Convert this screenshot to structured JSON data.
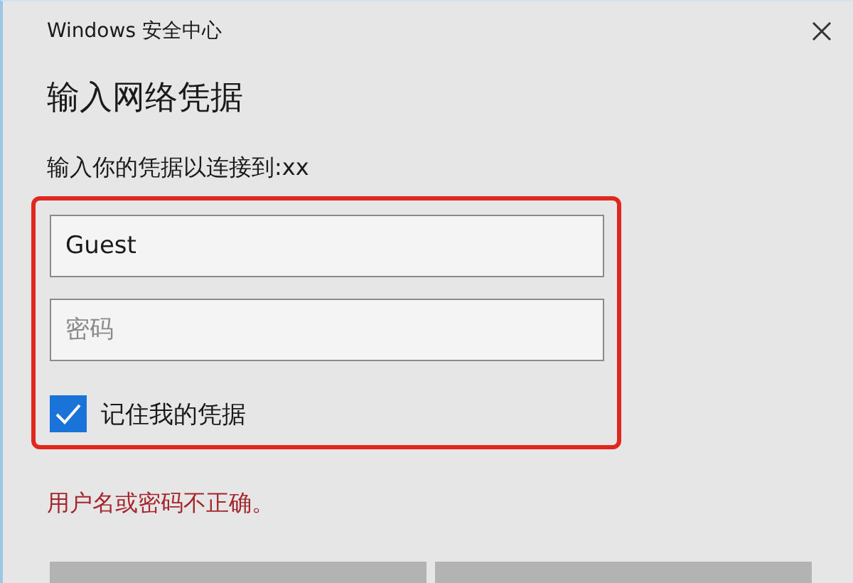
{
  "window": {
    "title": "Windows 安全中心"
  },
  "heading": "输入网络凭据",
  "prompt": "输入你的凭据以连接到:xx",
  "fields": [
    {
      "kind": "text",
      "value": "Guest"
    },
    {
      "kind": "password",
      "placeholder": "密码"
    }
  ],
  "remember": {
    "label": "记住我的凭据",
    "checked": true
  },
  "error": "用户名或密码不正确。"
}
